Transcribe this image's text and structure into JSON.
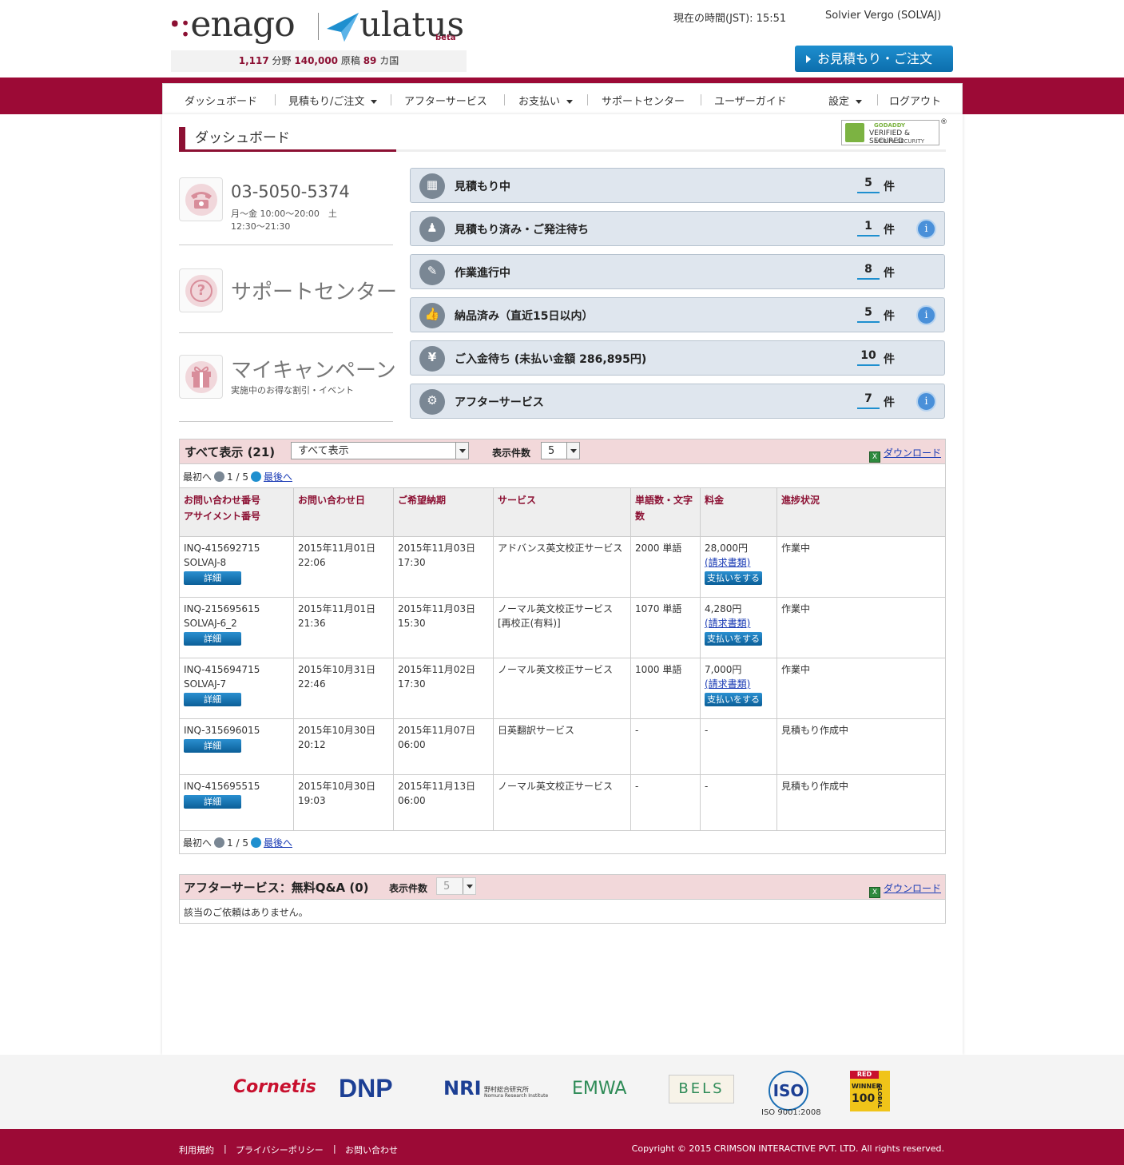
{
  "header": {
    "logo_enago": "enago",
    "logo_ulatus": "ulatus",
    "logo_beta": "beta",
    "stats_fields": "1,117",
    "stats_fields_label": "分野",
    "stats_docs": "140,000",
    "stats_docs_label": "原稿",
    "stats_countries": "89",
    "stats_countries_label": "カ国",
    "time_label": "現在の時間(JST): 15:51",
    "user_name": "Solvier Vergo (SOLVAJ)",
    "quote_button": "お見積もり・ご注文"
  },
  "nav": {
    "items": [
      "ダッシュボード",
      "見積もり/ご注文",
      "アフターサービス",
      "お支払い",
      "サポートセンター",
      "ユーザーガイド",
      "設定",
      "ログアウト"
    ]
  },
  "page": {
    "title": "ダッシュボード",
    "godaddy": {
      "line1": "GODADDY",
      "line2": "VERIFIED & SECURED",
      "line3": "VERIFY SECURITY",
      "reg": "®"
    }
  },
  "left": {
    "phone": "03-5050-5374",
    "hours": "月〜金 10:00〜20:00　土 12:30〜21:30",
    "support": "サポートセンター",
    "campaign": "マイキャンペーン",
    "campaign_sub": "実施中のお得な割引・イベント"
  },
  "status": [
    {
      "label": "見積もり中",
      "count": "5",
      "unit": "件",
      "icon": "calculator-icon",
      "glyph": "▦",
      "info": false
    },
    {
      "label": "見積もり済み・ご発注待ち",
      "count": "1",
      "unit": "件",
      "icon": "stamp-icon",
      "glyph": "♟",
      "info": true
    },
    {
      "label": "作業進行中",
      "count": "8",
      "unit": "件",
      "icon": "edit-icon",
      "glyph": "✎",
      "info": false
    },
    {
      "label": "納品済み（直近15日以内）",
      "count": "5",
      "unit": "件",
      "icon": "thumbs-up-icon",
      "glyph": "👍",
      "info": true
    },
    {
      "label": "ご入金待ち (未払い金額 286,895円)",
      "count": "10",
      "unit": "件",
      "icon": "yen-icon",
      "glyph": "¥",
      "info": false
    },
    {
      "label": "アフターサービス",
      "count": "7",
      "unit": "件",
      "icon": "gear-icon",
      "glyph": "⚙",
      "info": true
    }
  ],
  "orders": {
    "title": "すべて表示 (21)",
    "filter_value": "すべて表示",
    "per_page_label": "表示件数",
    "per_page_value": "5",
    "download": "ダウンロード",
    "pager_first": "最初へ",
    "pager_pos": "1 / 5",
    "pager_last": "最後へ",
    "columns": [
      "お問い合わせ番号",
      "アサイメント番号",
      "お問い合わせ日",
      "ご希望納期",
      "サービス",
      "単語数・文字数",
      "料金",
      "進捗状況"
    ],
    "detail_label": "詳細",
    "invoice_label": "(請求書類)",
    "pay_label": "支払いをする",
    "rows": [
      {
        "inq": "INQ-415692715",
        "assign": "SOLVAJ-8",
        "date": "2015年11月01日",
        "time": "22:06",
        "due": "2015年11月03日",
        "due_time": "17:30",
        "service": "アドバンス英文校正サービス",
        "service2": "",
        "words": "2000 単語",
        "fee": "28,000円",
        "status": "作業中",
        "has_pay": true
      },
      {
        "inq": "INQ-215695615",
        "assign": "SOLVAJ-6_2",
        "date": "2015年11月01日",
        "time": "21:36",
        "due": "2015年11月03日",
        "due_time": "15:30",
        "service": "ノーマル英文校正サービス",
        "service2": "[再校正(有料)]",
        "words": "1070 単語",
        "fee": "4,280円",
        "status": "作業中",
        "has_pay": true
      },
      {
        "inq": "INQ-415694715",
        "assign": "SOLVAJ-7",
        "date": "2015年10月31日",
        "time": "22:46",
        "due": "2015年11月02日",
        "due_time": "17:30",
        "service": "ノーマル英文校正サービス",
        "service2": "",
        "words": "1000 単語",
        "fee": "7,000円",
        "status": "作業中",
        "has_pay": true
      },
      {
        "inq": "INQ-315696015",
        "assign": "",
        "date": "2015年10月30日",
        "time": "20:12",
        "due": "2015年11月07日",
        "due_time": "06:00",
        "service": "日英翻訳サービス",
        "service2": "",
        "words": "-",
        "fee": "-",
        "status": "見積もり作成中",
        "has_pay": false
      },
      {
        "inq": "INQ-415695515",
        "assign": "",
        "date": "2015年10月30日",
        "time": "19:03",
        "due": "2015年11月13日",
        "due_time": "06:00",
        "service": "ノーマル英文校正サービス",
        "service2": "",
        "words": "-",
        "fee": "-",
        "status": "見積もり作成中",
        "has_pay": false
      }
    ]
  },
  "qa": {
    "title": "アフターサービス：無料Q&A (0)",
    "per_page_label": "表示件数",
    "per_page_value": "5",
    "download": "ダウンロード",
    "empty": "該当のご依頼はありません。"
  },
  "partners": [
    "Cornetis",
    "DNP",
    "NRI",
    "野村総合研究所",
    "Nomura Research Institute",
    "EMWA",
    "BELS",
    "ISO",
    "ISO 9001:2008",
    "RED HERRING",
    "WINNER",
    "100",
    "GLOBAL"
  ],
  "footer": {
    "links": [
      "利用規約",
      "プライバシーポリシー",
      "お問い合わせ"
    ],
    "copyright": "Copyright © 2015 CRIMSON INTERACTIVE PVT. LTD. All rights reserved."
  },
  "colors": {
    "brand": "#9c0a36",
    "accent": "#1e8fcf",
    "panel": "#dfe6ee",
    "table_head": "#f2d8da"
  }
}
